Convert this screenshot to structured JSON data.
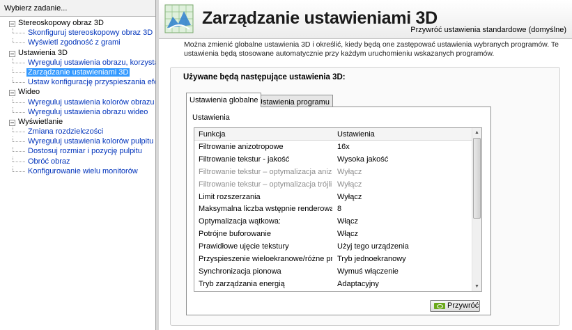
{
  "tree": {
    "header": "Wybierz zadanie...",
    "categories": [
      {
        "label": "Stereoskopowy obraz 3D",
        "items": [
          {
            "label": "Skonfiguruj stereoskopowy obraz 3D"
          },
          {
            "label": "Wyświetl zgodność z grami"
          }
        ]
      },
      {
        "label": "Ustawienia 3D",
        "items": [
          {
            "label": "Wyreguluj ustawienia obrazu, korzystając z"
          },
          {
            "label": "Zarządzanie ustawieniami 3D",
            "selected": true
          },
          {
            "label": "Ustaw konfigurację przyspieszania efektów"
          }
        ]
      },
      {
        "label": "Wideo",
        "items": [
          {
            "label": "Wyreguluj ustawienia kolorów obrazu wideo"
          },
          {
            "label": "Wyreguluj ustawienia obrazu wideo"
          }
        ]
      },
      {
        "label": "Wyświetlanie",
        "items": [
          {
            "label": "Zmiana rozdzielczości"
          },
          {
            "label": "Wyreguluj ustawienia kolorów pulpitu"
          },
          {
            "label": "Dostosuj rozmiar i pozycję pulpitu"
          },
          {
            "label": "Obróć obraz"
          },
          {
            "label": "Konfigurowanie wielu monitorów"
          }
        ]
      }
    ]
  },
  "page": {
    "title": "Zarządzanie ustawieniami 3D",
    "restore_link": "Przywróć ustawienia standardowe (domyślne)",
    "description": "Można zmienić globalne ustawienia 3D i określić, kiedy będą one zastępować ustawienia wybranych programów. Te ustawienia będą stosowane automatycznie przy każdym uruchomieniu wskazanych programów.",
    "group_heading": "Używane będą następujące ustawienia 3D:",
    "tabs": [
      {
        "label": "Ustawienia globalne",
        "active": true
      },
      {
        "label": "Ustawienia programu",
        "active": false
      }
    ],
    "panel_label": "Ustawienia",
    "table": {
      "col_function": "Funkcja",
      "col_setting": "Ustawienia",
      "rows": [
        {
          "function": "Filtrowanie anizotropowe",
          "value": "16x",
          "disabled": false
        },
        {
          "function": "Filtrowanie tekstur - jakość",
          "value": "Wysoka jakość",
          "disabled": false
        },
        {
          "function": "Filtrowanie tekstur – optymalizacja anizotr…",
          "value": "Wyłącz",
          "disabled": true
        },
        {
          "function": "Filtrowanie tekstur – optymalizacja trójlini…",
          "value": "Wyłącz",
          "disabled": true
        },
        {
          "function": "Limit rozszerzania",
          "value": "Wyłącz",
          "disabled": false
        },
        {
          "function": "Maksymalna liczba wstępnie renderowany…",
          "value": "8",
          "disabled": false
        },
        {
          "function": "Optymalizacja wątkowa:",
          "value": "Włącz",
          "disabled": false
        },
        {
          "function": "Potrójne buforowanie",
          "value": "Włącz",
          "disabled": false
        },
        {
          "function": "Prawidłowe ujęcie tekstury",
          "value": "Użyj tego urządzenia",
          "disabled": false
        },
        {
          "function": "Przyspieszenie wieloekranowe/różne proc…",
          "value": "Tryb jednoekranowy",
          "disabled": false
        },
        {
          "function": "Synchronizacja pionowa",
          "value": "Wymuś włączenie",
          "disabled": false
        },
        {
          "function": "Tryb zarządzania energią",
          "value": "Adaptacyjny",
          "disabled": false
        }
      ]
    },
    "apply_button": "Przywróć"
  }
}
